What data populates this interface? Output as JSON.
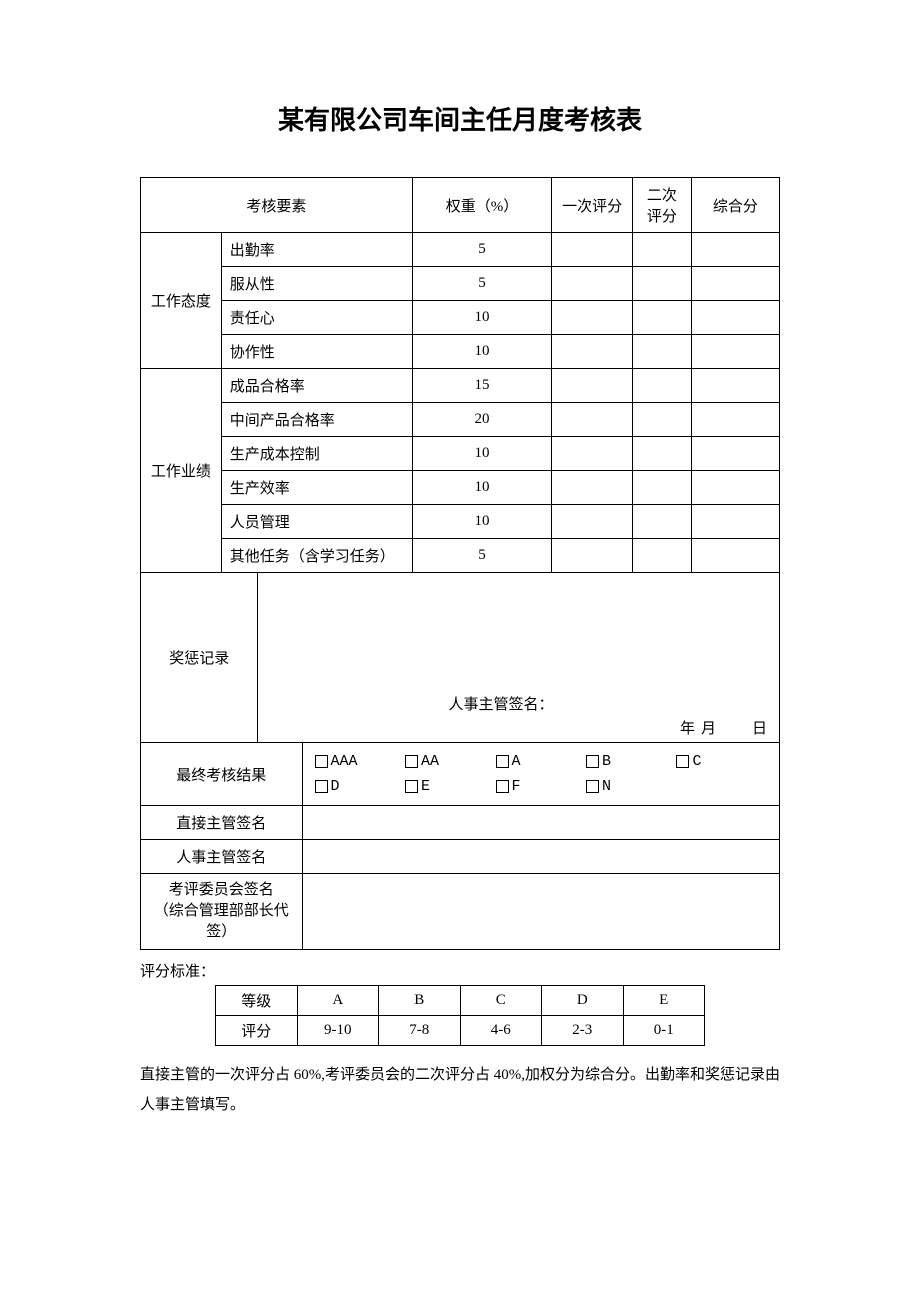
{
  "title": "某有限公司车间主任月度考核表",
  "headers": {
    "factor": "考核要素",
    "weight": "权重（%）",
    "score1": "一次评分",
    "score2": "二次评分",
    "total": "综合分"
  },
  "groups": [
    {
      "name": "工作态度",
      "items": [
        {
          "label": "出勤率",
          "weight": "5"
        },
        {
          "label": "服从性",
          "weight": "5"
        },
        {
          "label": "责任心",
          "weight": "10"
        },
        {
          "label": "协作性",
          "weight": "10"
        }
      ]
    },
    {
      "name": "工作业绩",
      "items": [
        {
          "label": "成品合格率",
          "weight": "15"
        },
        {
          "label": "中间产品合格率",
          "weight": "20"
        },
        {
          "label": "生产成本控制",
          "weight": "10"
        },
        {
          "label": "生产效率",
          "weight": "10"
        },
        {
          "label": "人员管理",
          "weight": "10"
        },
        {
          "label": "其他任务（含学习任务）",
          "weight": "5"
        }
      ]
    }
  ],
  "record": {
    "label": "奖惩记录",
    "signature_label": "人事主管签名：",
    "date_y": "年",
    "date_m": "月",
    "date_d": "日"
  },
  "final": {
    "label": "最终考核结果",
    "options": [
      "AAA",
      "AA",
      "A",
      "B",
      "C",
      "D",
      "E",
      "F",
      "N"
    ]
  },
  "signatures": {
    "direct": "直接主管签名",
    "hr": "人事主管签名",
    "committee_l1": "考评委员会签名",
    "committee_l2": "（综合管理部部长代签）"
  },
  "criteria": {
    "label": "评分标准：",
    "headers": [
      "等级",
      "A",
      "B",
      "C",
      "D",
      "E"
    ],
    "row_label": "评分",
    "values": [
      "9-10",
      "7-8",
      "4-6",
      "2-3",
      "0-1"
    ]
  },
  "footer": "直接主管的一次评分占 60%,考评委员会的二次评分占 40%,加权分为综合分。出勤率和奖惩记录由人事主管填写。"
}
